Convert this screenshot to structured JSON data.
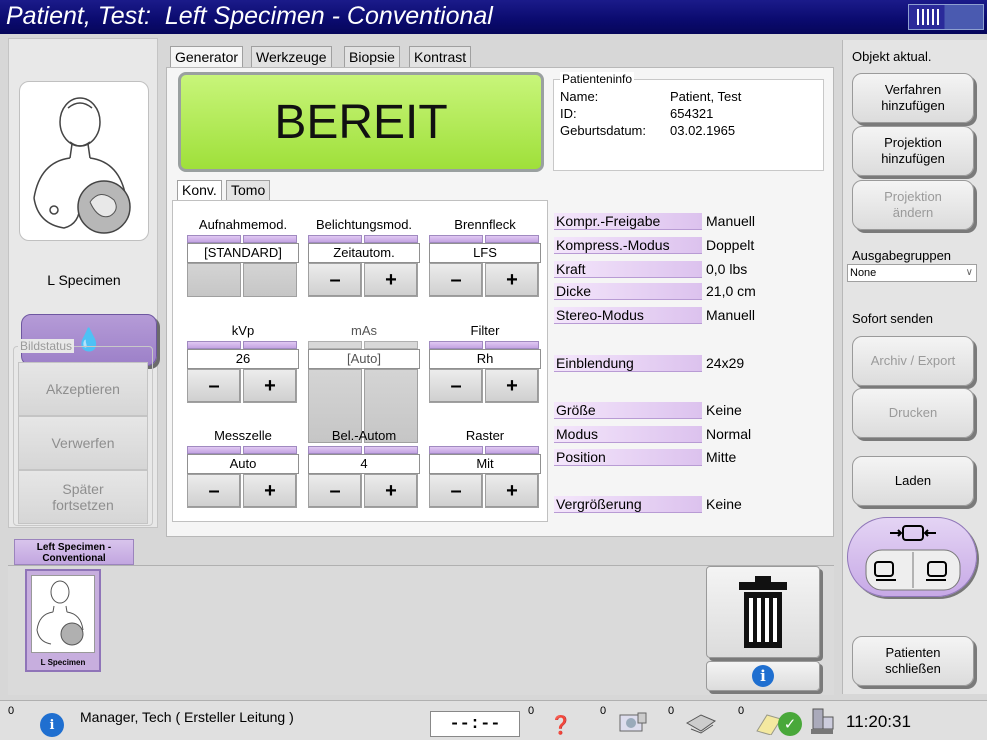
{
  "window": {
    "title": "Patient, Test:  Left Specimen - Conventional"
  },
  "left": {
    "view_label": "L Specimen",
    "bildstatus_legend": "Bildstatus",
    "status_buttons": [
      "Akzeptieren",
      "Verwerfen",
      "Später\nfortsetzen"
    ]
  },
  "tabs": [
    "Generator",
    "Werkzeuge",
    "Biopsie",
    "Kontrast"
  ],
  "ready_text": "BEREIT",
  "patient_info": {
    "legend": "Patienteninfo",
    "name_label": "Name:",
    "name_value": "Patient, Test",
    "id_label": "ID:",
    "id_value": "654321",
    "dob_label": "Geburtsdatum:",
    "dob_value": "03.02.1965"
  },
  "subtabs": [
    "Konv.",
    "Tomo"
  ],
  "controls": {
    "aufnahmemod": {
      "label": "Aufnahmemod.",
      "value": "[STANDARD]"
    },
    "belichtungsmod": {
      "label": "Belichtungsmod.",
      "value": "Zeitautom."
    },
    "brennfleck": {
      "label": "Brennfleck",
      "value": "LFS"
    },
    "kvp": {
      "label": "kVp",
      "value": "26"
    },
    "mas": {
      "label": "mAs",
      "value": "[Auto]"
    },
    "filter": {
      "label": "Filter",
      "value": "Rh"
    },
    "messzelle": {
      "label": "Messzelle",
      "value": "Auto"
    },
    "belautom": {
      "label": "Bel.-Autom",
      "value": "4"
    },
    "raster": {
      "label": "Raster",
      "value": "Mit"
    },
    "minus": "–",
    "plus": "+"
  },
  "parameters": [
    {
      "label": "Kompr.-Freigabe",
      "value": "Manuell"
    },
    {
      "label": "Kompress.-Modus",
      "value": "Doppelt"
    },
    {
      "label": "Kraft",
      "value": "0,0 lbs"
    },
    {
      "label": "Dicke",
      "value": "21,0 cm"
    },
    {
      "label": "Stereo-Modus",
      "value": "Manuell"
    },
    {
      "label": "Einblendung",
      "value": "24x29"
    },
    {
      "label": "Größe",
      "value": "Keine"
    },
    {
      "label": "Modus",
      "value": "Normal"
    },
    {
      "label": "Position",
      "value": "Mitte"
    },
    {
      "label": "Vergrößerung",
      "value": "Keine"
    }
  ],
  "right": {
    "objekt_label": "Objekt aktual.",
    "verfahren": "Verfahren\nhinzufügen",
    "projektion_add": "Projektion\nhinzufügen",
    "projektion_change": "Projektion\nändern",
    "ausgabe_label": "Ausgabegruppen",
    "ausgabe_value": "None",
    "sofort_label": "Sofort senden",
    "archiv": "Archiv  / Export",
    "drucken": "Drucken",
    "laden": "Laden",
    "schliessen": "Patienten\nschließen"
  },
  "strip": {
    "tab_label": "Left Specimen -\nConventional",
    "thumb_caption": "L Specimen"
  },
  "status": {
    "alarm_count": "0",
    "user": "Manager, Tech ( Ersteller Leitung )",
    "timer": "--:--",
    "count_a": "0",
    "count_b": "0",
    "count_c": "0",
    "count_d": "0",
    "time": "11:20:31"
  },
  "colors": {
    "title_bar": "#0a0a6e",
    "ready": "#a8e842",
    "accent_purple": "#b59bd7"
  }
}
